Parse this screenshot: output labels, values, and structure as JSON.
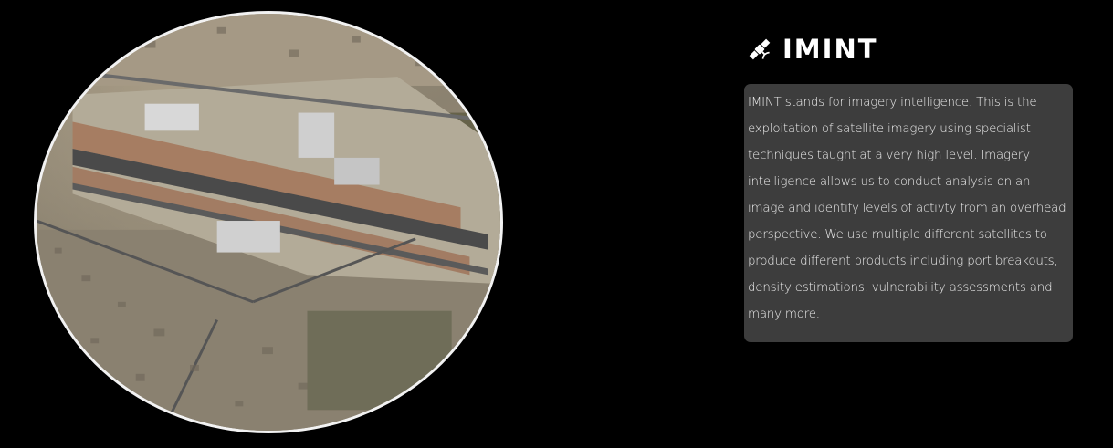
{
  "section": {
    "icon": "satellite-icon",
    "title": "IMINT",
    "description": "IMINT stands for imagery intelligence. This is the exploitation of satellite imagery using specialist techniques taught at a very high level. Imagery intelligence allows us to conduct analysis on an image and identify levels of activty from an overhead perspective. We use multiple different satellites to produce different products including port breakouts, density estimations, vulnerability assessments and many more."
  },
  "image": {
    "subject": "satellite-imagery-airport"
  },
  "colors": {
    "background": "#000000",
    "box": "#3d3d3d",
    "text": "#ececec",
    "title": "#ffffff",
    "frame": "#f2f2f2"
  }
}
